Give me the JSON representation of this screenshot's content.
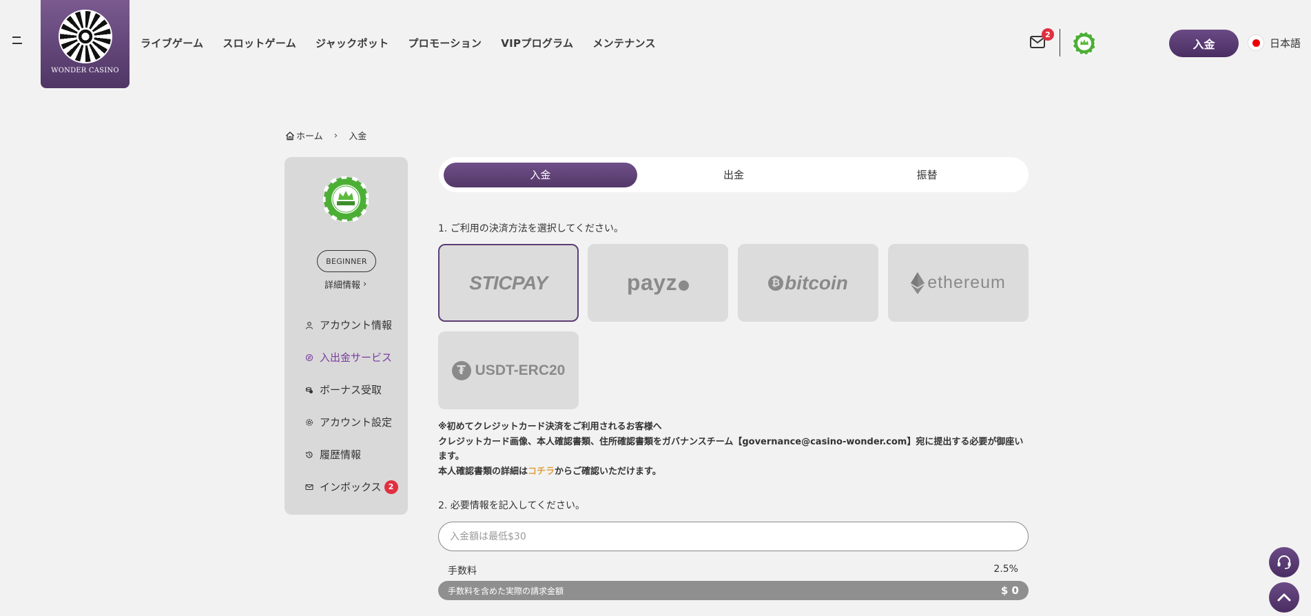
{
  "header": {
    "logo_text": "WONDER CASINO",
    "nav": [
      "ライブゲーム",
      "スロットゲーム",
      "ジャックポット",
      "プロモーション",
      "VIPプログラム",
      "メンテナンス"
    ],
    "mail_count": "2",
    "deposit_label": "入金",
    "language": "日本語"
  },
  "breadcrumb": {
    "home": "ホーム",
    "current": "入金"
  },
  "sidebar": {
    "level": "BEGINNER",
    "detail_link": "詳細情報",
    "items": [
      {
        "label": "アカウント情報",
        "icon": "user-icon"
      },
      {
        "label": "入出金サービス",
        "icon": "exchange-icon",
        "active": true
      },
      {
        "label": "ボーナス受取",
        "icon": "coins-icon"
      },
      {
        "label": "アカウント設定",
        "icon": "gear-icon"
      },
      {
        "label": "履歴情報",
        "icon": "history-icon"
      },
      {
        "label": "インボックス",
        "icon": "mail-icon",
        "badge": "2"
      }
    ]
  },
  "tabs": {
    "deposit": "入金",
    "withdraw": "出金",
    "transfer": "振替"
  },
  "step1": "1. ご利用の決済方法を選択してください。",
  "payment_methods": {
    "sticpay": "STICPAY",
    "payz": "payz",
    "bitcoin": "bitcoin",
    "ethereum": "ethereum",
    "usdt": "USDT-ERC20"
  },
  "notice": {
    "line1": "※初めてクレジットカード決済をご利用されるお客様へ",
    "line2": "クレジットカード画像、本人確認書類、住所確認書類をガバナンスチーム【governance@casino-wonder.com】宛に提出する必要が御座います。",
    "line3_pre": "本人確認書類の詳細は",
    "line3_link": "コチラ",
    "line3_post": "からご確認いただけます。"
  },
  "step2": "2. 必要情報を記入してください。",
  "amount": {
    "placeholder": "入金額は最低$30"
  },
  "fee": {
    "label": "手数料",
    "value": "2.5%"
  },
  "total": {
    "label": "手数料を含めた実際の請求金額",
    "value": "$ 0"
  },
  "colors": {
    "brand": "#5b3c75",
    "accent_link": "#e0a040",
    "badge": "#e03040"
  }
}
